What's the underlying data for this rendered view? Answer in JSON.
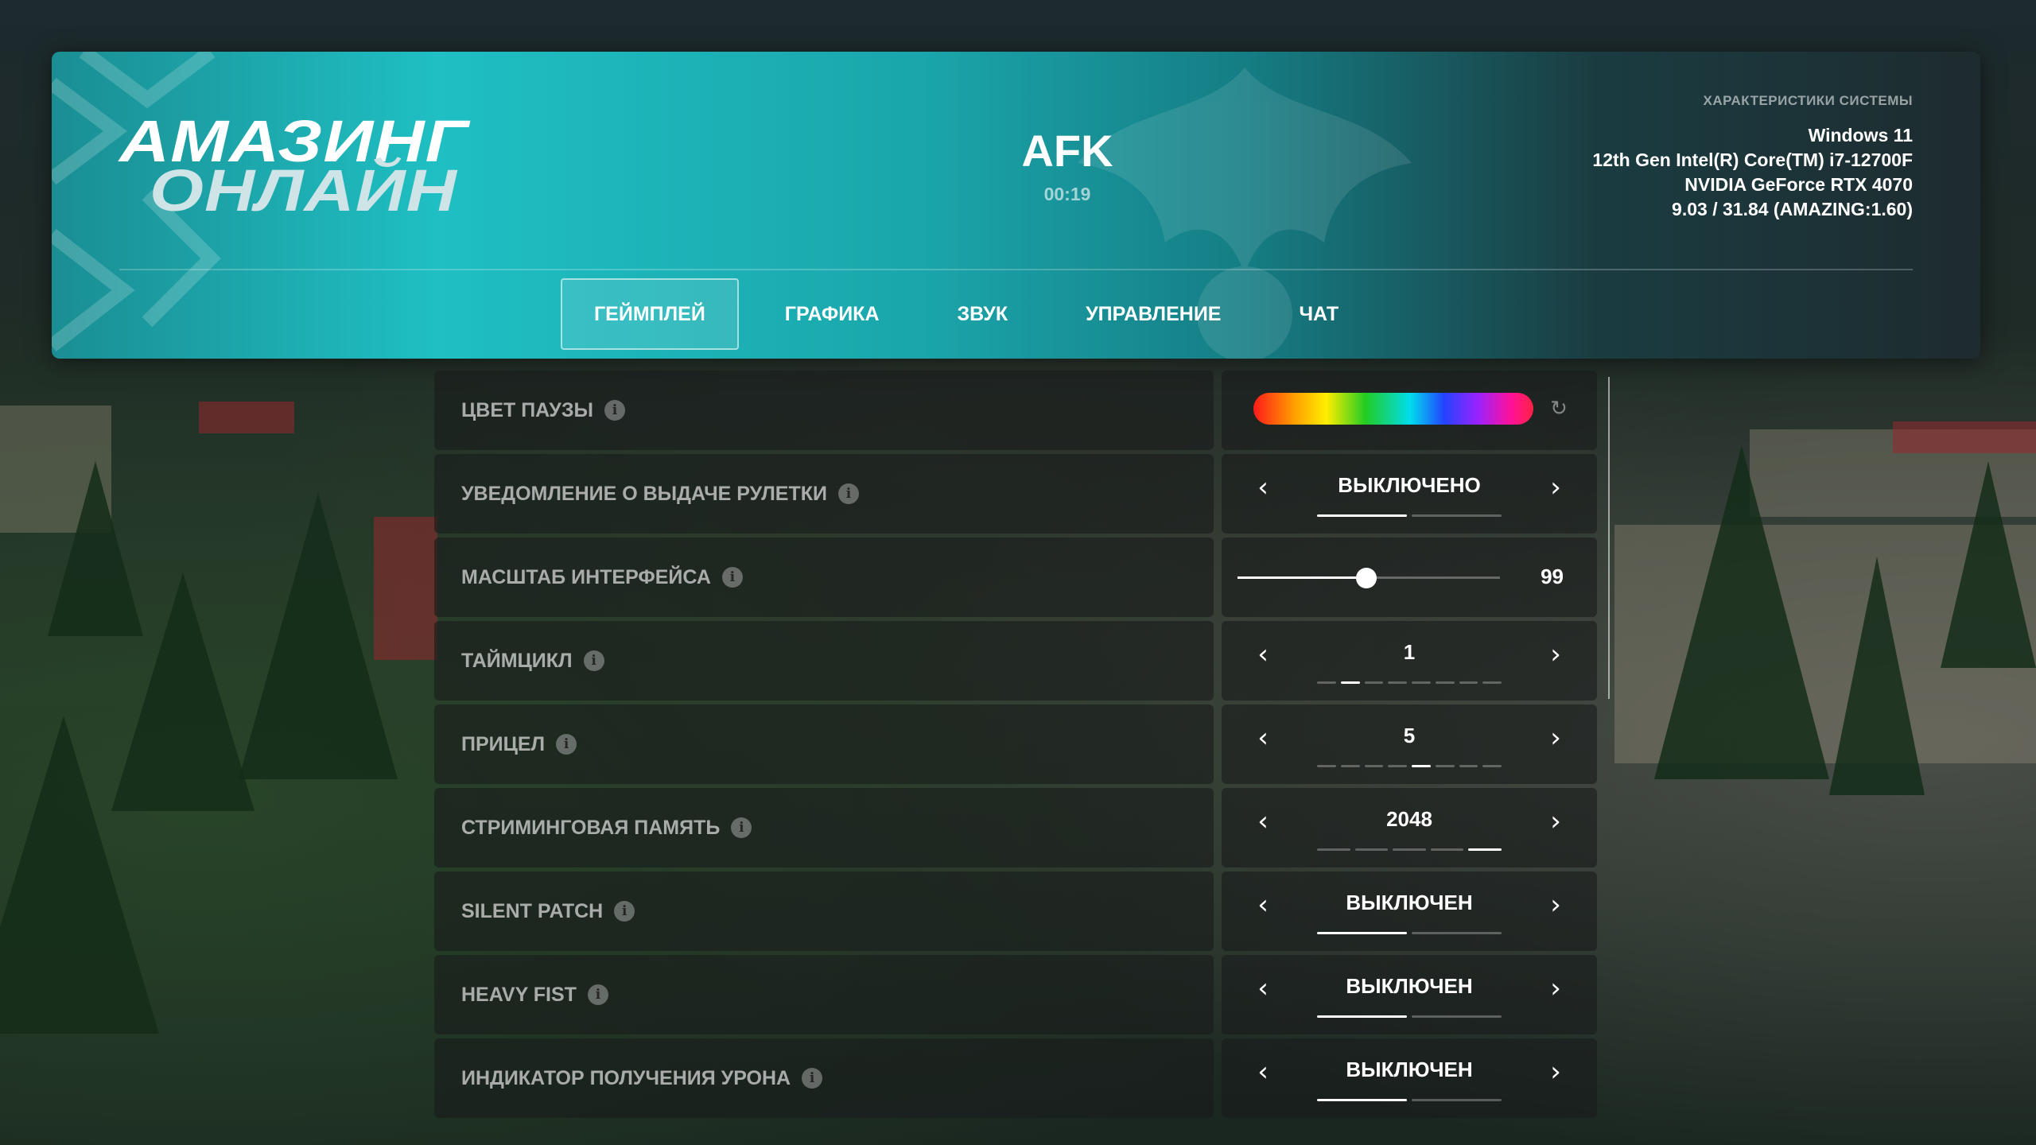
{
  "logo": {
    "line1": "АМАЗИНГ",
    "line2": "ОНЛАЙН"
  },
  "status": {
    "title": "AFK",
    "timer": "00:19"
  },
  "system": {
    "title": "ХАРАКТЕРИСТИКИ СИСТЕМЫ",
    "os": "Windows 11",
    "cpu": "12th Gen Intel(R) Core(TM) i7-12700F",
    "gpu": "NVIDIA GeForce RTX 4070",
    "version": "9.03 / 31.84 (AMAZING:1.60)"
  },
  "tabs": [
    {
      "label": "ГЕЙМПЛЕЙ",
      "active": true
    },
    {
      "label": "ГРАФИКА",
      "active": false
    },
    {
      "label": "ЗВУК",
      "active": false
    },
    {
      "label": "УПРАВЛЕНИЕ",
      "active": false
    },
    {
      "label": "ЧАТ",
      "active": false
    }
  ],
  "settings": {
    "pause_color": {
      "label": "ЦВЕТ ПАУЗЫ"
    },
    "roulette_notify": {
      "label": "УВЕДОМЛЕНИЕ О ВЫДАЧЕ РУЛЕТКИ",
      "value": "ВЫКЛЮЧЕНО",
      "segments": 2,
      "active_index": 0
    },
    "ui_scale": {
      "label": "МАСШТАБ ИНТЕРФЕЙСА",
      "value": "99",
      "fraction": 0.49
    },
    "timecycle": {
      "label": "ТАЙМЦИКЛ",
      "value": "1",
      "segments": 8,
      "active_index": 1
    },
    "crosshair": {
      "label": "ПРИЦЕЛ",
      "value": "5",
      "segments": 8,
      "active_index": 4
    },
    "streaming_memory": {
      "label": "СТРИМИНГОВАЯ ПАМЯТЬ",
      "value": "2048",
      "segments": 5,
      "active_index": 4
    },
    "silent_patch": {
      "label": "SILENT PATCH",
      "value": "ВЫКЛЮЧЕН",
      "segments": 2,
      "active_index": 0
    },
    "heavy_fist": {
      "label": "HEAVY FIST",
      "value": "ВЫКЛЮЧЕН",
      "segments": 2,
      "active_index": 0
    },
    "damage_indicator": {
      "label": "ИНДИКАТОР ПОЛУЧЕНИЯ УРОНА",
      "value": "ВЫКЛЮЧЕН",
      "segments": 2,
      "active_index": 0
    }
  },
  "icons": {
    "info": "i",
    "arrow_left": "‹",
    "arrow_right": "›",
    "reset": "↻"
  }
}
